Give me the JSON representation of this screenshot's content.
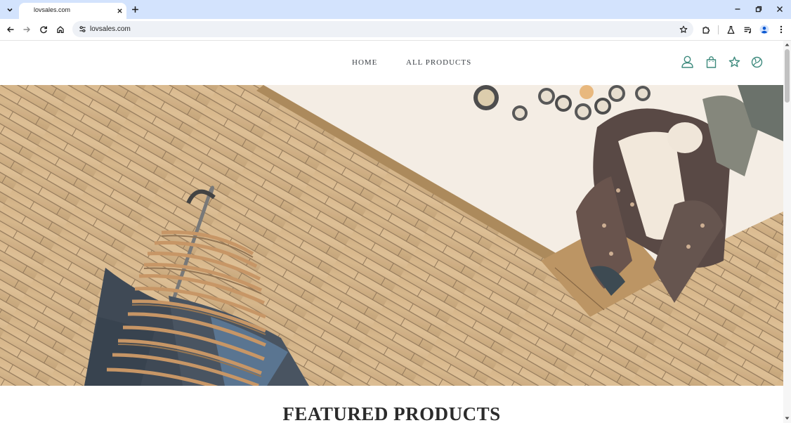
{
  "browser": {
    "tab": {
      "title": "lovsales.com"
    },
    "address_bar": {
      "url": "lovsales.com"
    },
    "icons": {
      "tab_list": "chevron-down-icon",
      "tab_close": "close-icon",
      "new_tab": "plus-icon",
      "minimize": "minimize-icon",
      "restore": "restore-icon",
      "close_window": "close-icon",
      "back": "arrow-left-icon",
      "forward": "arrow-right-icon",
      "reload": "reload-icon",
      "home": "home-icon",
      "site_info": "tune-icon",
      "bookmark": "star-icon",
      "extensions": "puzzle-icon",
      "labs": "flask-icon",
      "media": "media-queue-icon",
      "profile": "account-circle-icon",
      "menu": "kebab-menu-icon"
    }
  },
  "site": {
    "nav": [
      {
        "label": "HOME"
      },
      {
        "label": "ALL PRODUCTS"
      }
    ],
    "header_icons": [
      "user-icon",
      "shopping-bag-icon",
      "puzzle-star-icon",
      "globe-icon"
    ],
    "hero": {
      "image": "hero-image"
    },
    "featured": {
      "heading": "FEATURED PRODUCTS"
    }
  },
  "colors": {
    "tab_strip": "#d3e3fd",
    "omnibox": "#eef1f6",
    "site_icons": "#3d8a7d",
    "nav_text": "#3b4046"
  }
}
